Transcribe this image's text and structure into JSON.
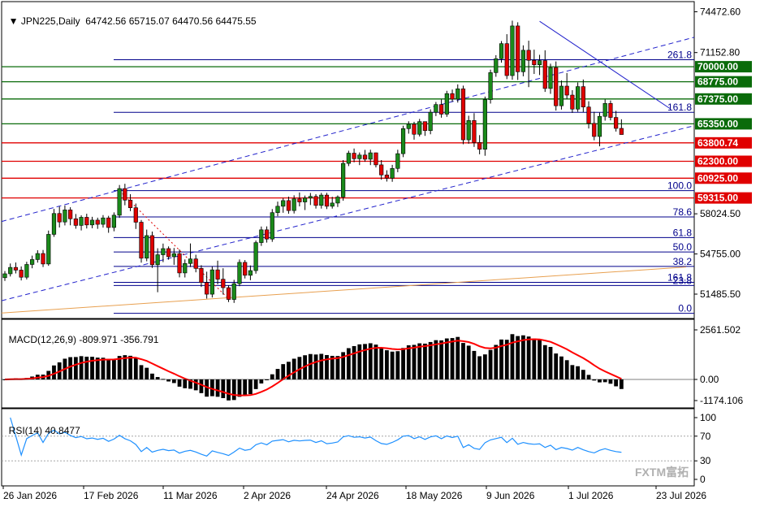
{
  "chart_data": {
    "type": "candlestick",
    "symbol": "JPN225",
    "timeframe": "Daily",
    "ohlc_header": {
      "open": "64742.56",
      "high": "65715.07",
      "low": "64470.56",
      "close": "64475.55"
    },
    "price_axis": {
      "ticks": [
        "74472.60",
        "71152.80",
        "58024.50",
        "54755.00",
        "51485.50"
      ],
      "ylim": [
        49500,
        75300
      ]
    },
    "date_axis": {
      "labels": [
        "26 Jan 2026",
        "17 Feb 2026",
        "11 Mar 2026",
        "2 Apr 2026",
        "24 Apr 2026",
        "18 May 2026",
        "9 Jun 2026",
        "1 Jul 2026",
        "23 Jul 2026"
      ]
    },
    "candles": [
      [
        52820,
        53360,
        52560,
        53140
      ],
      [
        53140,
        53980,
        52920,
        53660
      ],
      [
        53660,
        54060,
        53170,
        53440
      ],
      [
        53440,
        53740,
        52600,
        52860
      ],
      [
        52860,
        54120,
        52680,
        53900
      ],
      [
        53900,
        54620,
        53590,
        54300
      ],
      [
        54300,
        55060,
        54050,
        54790
      ],
      [
        54790,
        55080,
        53690,
        53940
      ],
      [
        53940,
        56660,
        53790,
        56350
      ],
      [
        56350,
        58420,
        56150,
        58050
      ],
      [
        58050,
        58620,
        56910,
        57360
      ],
      [
        57360,
        58700,
        57080,
        58340
      ],
      [
        58340,
        58560,
        57090,
        57620
      ],
      [
        57620,
        58010,
        56810,
        57080
      ],
      [
        57080,
        57900,
        56670,
        57740
      ],
      [
        57740,
        58030,
        56830,
        57120
      ],
      [
        57120,
        57780,
        56850,
        57510
      ],
      [
        57510,
        57710,
        56800,
        57170
      ],
      [
        57170,
        57920,
        56900,
        57690
      ],
      [
        57690,
        57860,
        56480,
        56910
      ],
      [
        56910,
        58140,
        56600,
        57910
      ],
      [
        57910,
        60370,
        57690,
        60080
      ],
      [
        60080,
        60470,
        58720,
        59140
      ],
      [
        59140,
        59620,
        58240,
        58520
      ],
      [
        58520,
        58860,
        56790,
        57340
      ],
      [
        57340,
        57520,
        54050,
        54410
      ],
      [
        54410,
        56740,
        54160,
        56250
      ],
      [
        56250,
        56580,
        53620,
        53880
      ],
      [
        53880,
        55220,
        51640,
        54690
      ],
      [
        54690,
        55600,
        54090,
        55190
      ],
      [
        55190,
        55370,
        54290,
        54530
      ],
      [
        54530,
        55240,
        53870,
        54780
      ],
      [
        54780,
        55120,
        52850,
        53210
      ],
      [
        53210,
        54310,
        52840,
        53980
      ],
      [
        53980,
        55610,
        53690,
        54350
      ],
      [
        54350,
        54690,
        53260,
        53580
      ],
      [
        53580,
        53840,
        52070,
        52430
      ],
      [
        52430,
        53310,
        51120,
        51480
      ],
      [
        51480,
        53740,
        51210,
        53460
      ],
      [
        53460,
        54210,
        52280,
        52700
      ],
      [
        52700,
        53590,
        51450,
        52010
      ],
      [
        52010,
        52210,
        50840,
        51050
      ],
      [
        51050,
        52650,
        50770,
        52340
      ],
      [
        52340,
        54310,
        52130,
        54070
      ],
      [
        54070,
        54260,
        52760,
        53020
      ],
      [
        53020,
        53820,
        52620,
        53400
      ],
      [
        53400,
        55850,
        53150,
        55680
      ],
      [
        55680,
        56990,
        55410,
        56720
      ],
      [
        56720,
        57000,
        55680,
        55970
      ],
      [
        55970,
        58410,
        55740,
        58120
      ],
      [
        58120,
        59020,
        57830,
        58640
      ],
      [
        58640,
        59310,
        58110,
        59100
      ],
      [
        59100,
        59420,
        58030,
        58290
      ],
      [
        58290,
        59530,
        58050,
        59240
      ],
      [
        59240,
        59760,
        58630,
        58990
      ],
      [
        58990,
        59510,
        58330,
        59310
      ],
      [
        59310,
        59720,
        58740,
        59440
      ],
      [
        59440,
        59620,
        58450,
        58710
      ],
      [
        58710,
        59730,
        58450,
        59550
      ],
      [
        59550,
        59730,
        58410,
        58640
      ],
      [
        58640,
        59410,
        58450,
        58900
      ],
      [
        58900,
        59520,
        58580,
        59390
      ],
      [
        59390,
        62400,
        59090,
        62130
      ],
      [
        62130,
        63160,
        61910,
        62960
      ],
      [
        62960,
        63340,
        62220,
        62510
      ],
      [
        62510,
        63020,
        61990,
        62810
      ],
      [
        62810,
        63230,
        62260,
        62470
      ],
      [
        62470,
        63240,
        61990,
        62990
      ],
      [
        62990,
        63010,
        61800,
        62010
      ],
      [
        62010,
        62400,
        60800,
        61190
      ],
      [
        61190,
        61570,
        60650,
        60930
      ],
      [
        60930,
        62010,
        60630,
        61720
      ],
      [
        61720,
        63240,
        61410,
        62920
      ],
      [
        62920,
        65200,
        62640,
        64960
      ],
      [
        64960,
        65560,
        64550,
        65320
      ],
      [
        65320,
        65520,
        64060,
        64500
      ],
      [
        64500,
        65750,
        64320,
        65530
      ],
      [
        65530,
        65530,
        64370,
        64800
      ],
      [
        64800,
        66530,
        64500,
        66290
      ],
      [
        66290,
        67130,
        65980,
        66920
      ],
      [
        66920,
        67330,
        65850,
        66140
      ],
      [
        66140,
        68040,
        65920,
        67810
      ],
      [
        67810,
        68140,
        67140,
        67360
      ],
      [
        67360,
        68560,
        67080,
        68200
      ],
      [
        68200,
        68460,
        63690,
        64050
      ],
      [
        64050,
        66010,
        63730,
        65620
      ],
      [
        65620,
        66220,
        63470,
        63830
      ],
      [
        63830,
        64430,
        62870,
        63280
      ],
      [
        63280,
        67570,
        62750,
        67320
      ],
      [
        67320,
        69760,
        67000,
        69520
      ],
      [
        69520,
        70940,
        69180,
        70650
      ],
      [
        70650,
        72090,
        70330,
        71880
      ],
      [
        71880,
        72650,
        68990,
        69280
      ],
      [
        69280,
        73750,
        68940,
        73320
      ],
      [
        73320,
        73620,
        68920,
        69590
      ],
      [
        69590,
        71740,
        69220,
        71340
      ],
      [
        71340,
        72120,
        68340,
        70520
      ],
      [
        70520,
        71390,
        69410,
        70160
      ],
      [
        70160,
        70970,
        69320,
        70500
      ],
      [
        70500,
        71340,
        67950,
        68230
      ],
      [
        68230,
        70250,
        67790,
        69930
      ],
      [
        69930,
        70430,
        66430,
        66820
      ],
      [
        66820,
        68880,
        66510,
        68420
      ],
      [
        68420,
        69490,
        67380,
        67690
      ],
      [
        67690,
        68090,
        66240,
        66550
      ],
      [
        66550,
        68720,
        66330,
        68380
      ],
      [
        68380,
        68960,
        66300,
        66720
      ],
      [
        66720,
        67190,
        64970,
        65390
      ],
      [
        65390,
        66330,
        64010,
        64320
      ],
      [
        64320,
        66260,
        63520,
        65960
      ],
      [
        65960,
        67330,
        65610,
        67010
      ],
      [
        67010,
        67250,
        65630,
        65870
      ],
      [
        65870,
        66410,
        64720,
        64980
      ],
      [
        64980,
        65720,
        64470,
        64480
      ]
    ],
    "horizontal_levels": [
      {
        "price": 70000.0,
        "label": "70000.00",
        "color": "#0a6b0a"
      },
      {
        "price": 68775.0,
        "label": "68775.00",
        "color": "#0a6b0a"
      },
      {
        "price": 67375.0,
        "label": "67375.00",
        "color": "#0a6b0a"
      },
      {
        "price": 65350.0,
        "label": "65350.00",
        "color": "#0a6b0a"
      },
      {
        "price": 63800.74,
        "label": "63800.74",
        "color": "#e00000"
      },
      {
        "price": 62300.0,
        "label": "62300.00",
        "color": "#e00000"
      },
      {
        "price": 60925.0,
        "label": "60925.00",
        "color": "#e00000"
      },
      {
        "price": 59315.0,
        "label": "59315.00",
        "color": "#e00000"
      }
    ],
    "fibonacci": {
      "levels": [
        {
          "label": "261.8",
          "price": 70570
        },
        {
          "label": "161.8",
          "price": 66290
        },
        {
          "label": "100.0",
          "price": 59910
        },
        {
          "label": "78.6",
          "price": 57770
        },
        {
          "label": "61.8",
          "price": 56090
        },
        {
          "label": "50.0",
          "price": 54920
        },
        {
          "label": "38.2",
          "price": 53740
        },
        {
          "label": "161.8",
          "price": 52440
        },
        {
          "label": "23.8",
          "price": 52190
        },
        {
          "label": "0.0",
          "price": 49920
        }
      ]
    },
    "macd": {
      "label": "MACD(12,26,9)",
      "main": "-809.971",
      "signal": "-356.791",
      "ticks": [
        "2561.502",
        "0.00",
        "-1174.106"
      ]
    },
    "rsi": {
      "label": "RSI(14)",
      "value": "40.8477",
      "ticks": [
        "100",
        "70",
        "30",
        "0"
      ]
    },
    "colors": {
      "bull": "#1a8a1a",
      "bear": "#e00000",
      "trend": "#2222cc",
      "ma": "#e8a050",
      "rsi": "#1e90ff",
      "signal": "#ff0000"
    }
  },
  "watermark": {
    "text": "FXTM富拓"
  }
}
